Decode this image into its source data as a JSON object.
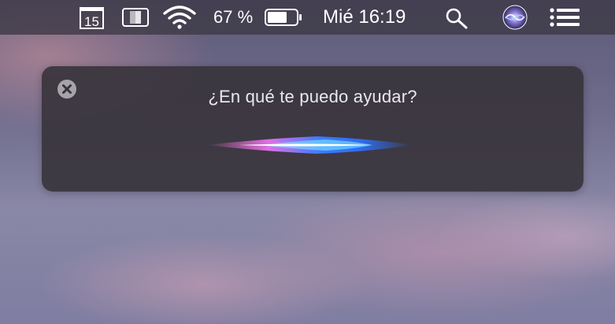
{
  "menubar": {
    "calendar_day": "15",
    "battery_percent": "67 %",
    "clock": "Mié 16:19"
  },
  "siri": {
    "prompt": "¿En qué te puedo ayudar?"
  },
  "colors": {
    "menubar_bg": "#3e3a48",
    "panel_bg": "#38343c",
    "waveform_blue": "#3d7bff",
    "waveform_pink": "#ff6fd0",
    "waveform_cyan": "#7fe8ff"
  }
}
